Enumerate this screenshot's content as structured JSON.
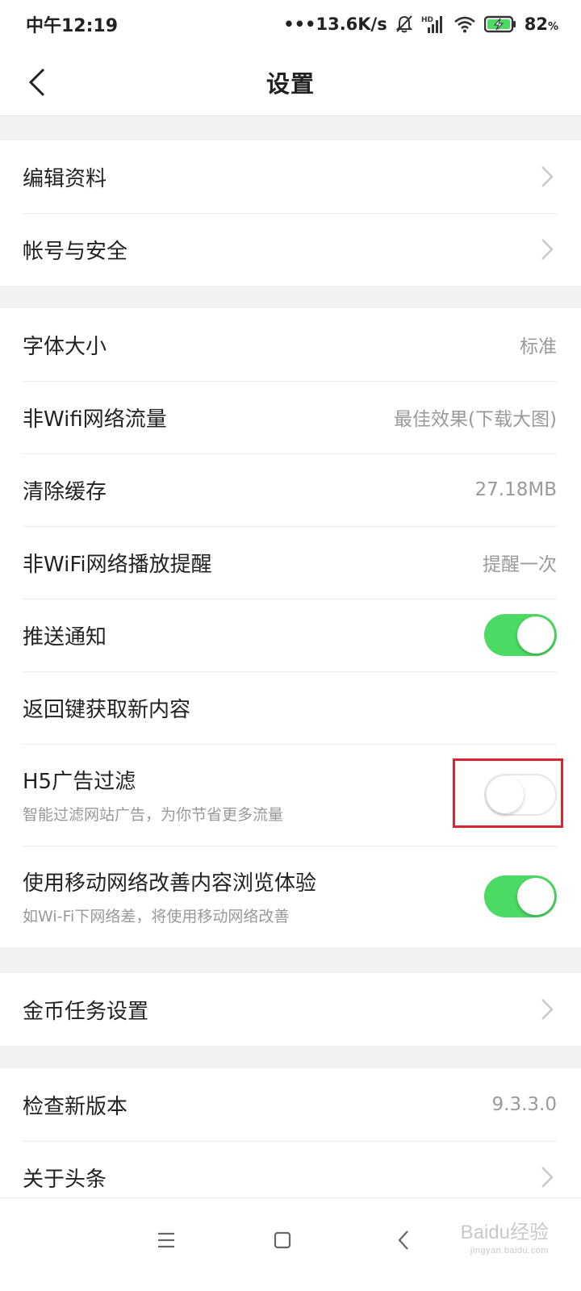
{
  "status_bar": {
    "time": "中午12:19",
    "network_speed": "•••13.6K/s",
    "hd_label": "HD",
    "battery_level": "82",
    "battery_unit": "%"
  },
  "nav": {
    "title": "设置"
  },
  "group1": {
    "edit_profile": "编辑资料",
    "account_security": "帐号与安全"
  },
  "group2": {
    "font_size": {
      "label": "字体大小",
      "value": "标准"
    },
    "non_wifi_traffic": {
      "label": "非Wifi网络流量",
      "value": "最佳效果(下载大图)"
    },
    "clear_cache": {
      "label": "清除缓存",
      "value": "27.18MB"
    },
    "non_wifi_play": {
      "label": "非WiFi网络播放提醒",
      "value": "提醒一次"
    },
    "push_notify": {
      "label": "推送通知",
      "on": true
    },
    "back_refresh": {
      "label": "返回键获取新内容"
    },
    "h5_ad_filter": {
      "label": "H5广告过滤",
      "sub": "智能过滤网站广告，为你节省更多流量",
      "on": false
    },
    "mobile_boost": {
      "label": "使用移动网络改善内容浏览体验",
      "sub": "如Wi-Fi下网络差，将使用移动网络改善",
      "on": true
    }
  },
  "group3": {
    "coin_task": "金币任务设置"
  },
  "group4": {
    "check_update": {
      "label": "检查新版本",
      "value": "9.3.3.0"
    },
    "about": "关于头条"
  },
  "watermark": {
    "text": "Baidu经验",
    "url": "jingyan.baidu.com"
  },
  "colors": {
    "toggle_on": "#4cd964",
    "highlight": "#d7262e"
  },
  "icons": [
    "back-arrow-icon",
    "chevron-right-icon",
    "menu-icon",
    "home-square-icon",
    "nav-back-icon",
    "mute-bell-icon",
    "signal-icon",
    "wifi-icon",
    "battery-charging-icon"
  ]
}
